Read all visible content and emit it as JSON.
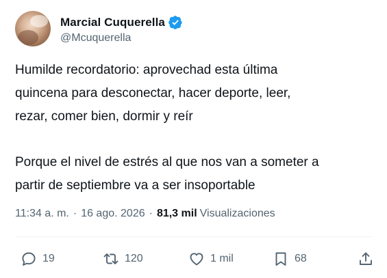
{
  "tweet": {
    "author": {
      "display_name": "Marcial Cuquerella",
      "handle": "@Mcuquerella",
      "verified": true
    },
    "body": {
      "paragraph_1": "Humilde recordatorio: aprovechad esta última\nquincena para desconectar, hacer deporte, leer,\nrezar, comer bien, dormir y reír",
      "paragraph_2": "Porque el nivel de estrés al que nos van a someter a\npartir de septiembre va a ser insoportable"
    },
    "meta": {
      "time": "11:34 a. m.",
      "separator": "·",
      "date": "16 ago. 2026",
      "views_count": "81,3 mil",
      "views_label": "Visualizaciones"
    },
    "actions": {
      "reply": {
        "icon": "reply-icon",
        "count": "19"
      },
      "retweet": {
        "icon": "retweet-icon",
        "count": "120"
      },
      "like": {
        "icon": "heart-icon",
        "count": "1 mil"
      },
      "bookmark": {
        "icon": "bookmark-icon",
        "count": "68"
      },
      "share": {
        "icon": "share-icon"
      }
    }
  },
  "colors": {
    "text_primary": "#0f1419",
    "text_secondary": "#536471",
    "verified_blue": "#1d9bf0",
    "divider": "#eff3f4"
  }
}
